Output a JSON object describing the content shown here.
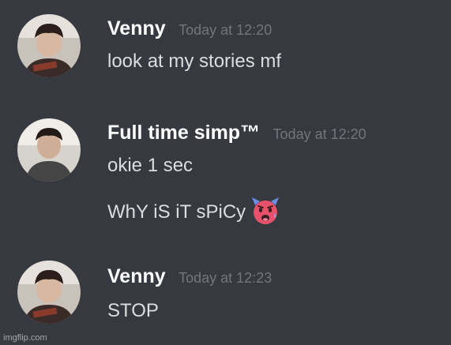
{
  "messages": [
    {
      "username": "Venny",
      "timestamp": "Today at 12:20",
      "lines": [
        "look at my stories mf"
      ]
    },
    {
      "username": "Full time simp™",
      "timestamp": "Today at 12:20",
      "lines": [
        "okie 1 sec",
        "WhY iS iT sPiCy"
      ],
      "emoji": "hot-face-devil-emoji"
    },
    {
      "username": "Venny",
      "timestamp": "Today at 12:23",
      "lines": [
        "STOP"
      ]
    }
  ],
  "watermark": "imgflip.com",
  "colors": {
    "background": "#36393f",
    "username": "#ffffff",
    "timestamp": "#72767d",
    "message_text": "#dcddde"
  }
}
